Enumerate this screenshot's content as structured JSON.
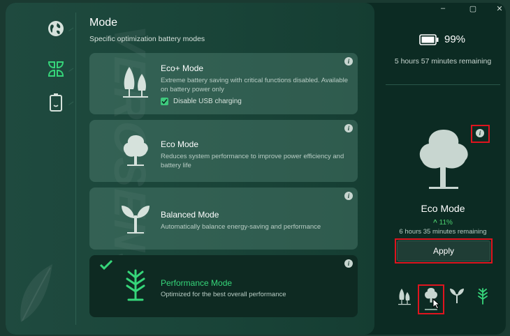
{
  "watermark": "VEROSENSE",
  "header": {
    "title": "Mode",
    "subtitle": "Specific optimization battery modes"
  },
  "sidebar": {
    "items": [
      {
        "icon": "globe-icon"
      },
      {
        "icon": "leaves-icon",
        "active": true
      },
      {
        "icon": "battery-icon"
      }
    ]
  },
  "modes": [
    {
      "title": "Eco+ Mode",
      "description": "Extreme battery saving with critical functions disabled. Available on battery power only",
      "icon": "two-trees-icon",
      "checkbox": {
        "label": "Disable USB charging",
        "checked": true
      }
    },
    {
      "title": "Eco Mode",
      "description": "Reduces system performance to improve power efficiency and battery life",
      "icon": "tree-icon"
    },
    {
      "title": "Balanced Mode",
      "description": "Automatically balance energy-saving and performance",
      "icon": "sprout-icon"
    },
    {
      "title": "Performance Mode",
      "description": "Optimized for the best overall performance",
      "icon": "branch-icon",
      "selected": true
    }
  ],
  "info_glyph": "i",
  "window": {
    "minimize": "–",
    "maximize": "▢",
    "close": "✕"
  },
  "battery": {
    "percent": "99%",
    "remaining": "5 hours 57 minutes remaining"
  },
  "preview": {
    "mode_name": "Eco Mode",
    "gain": "11%",
    "gain_arrow": "^",
    "estimated": "6 hours 35 minutes remaining",
    "apply_label": "Apply"
  },
  "colors": {
    "accent": "#36d67a",
    "highlight": "#e0141e",
    "background": "#0c2b23"
  }
}
